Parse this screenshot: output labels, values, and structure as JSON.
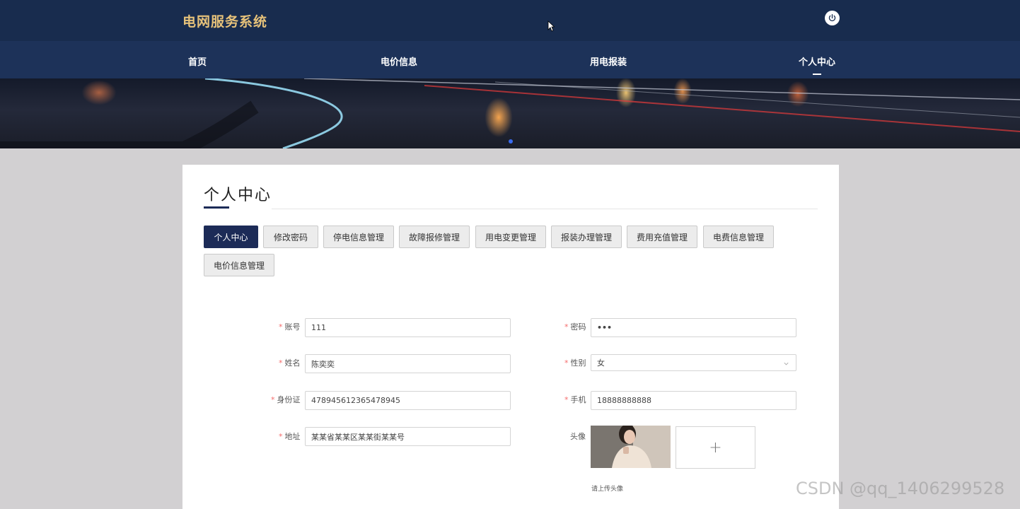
{
  "header": {
    "brand": "电网服务系统",
    "power_icon": "power-icon"
  },
  "nav": {
    "items": [
      {
        "label": "首页"
      },
      {
        "label": "电价信息"
      },
      {
        "label": "用电报装"
      },
      {
        "label": "个人中心",
        "active": true
      }
    ]
  },
  "banner": {
    "carousel_indicator": "dot"
  },
  "card": {
    "title": "个人中心",
    "tabs": [
      {
        "label": "个人中心",
        "active": true
      },
      {
        "label": "修改密码"
      },
      {
        "label": "停电信息管理"
      },
      {
        "label": "故障报修管理"
      },
      {
        "label": "用电变更管理"
      },
      {
        "label": "报装办理管理"
      },
      {
        "label": "费用充值管理"
      },
      {
        "label": "电费信息管理"
      },
      {
        "label": "电价信息管理"
      }
    ]
  },
  "form": {
    "account_label": "账号",
    "account_value": "111",
    "password_label": "密码",
    "password_value": "•••",
    "name_label": "姓名",
    "name_value": "陈奕奕",
    "gender_label": "性别",
    "gender_value": "女",
    "idcard_label": "身份证",
    "idcard_value": "478945612365478945",
    "phone_label": "手机",
    "phone_value": "18888888888",
    "address_label": "地址",
    "address_value": "某某省某某区某某街某某号",
    "avatar_label": "头像",
    "upload_tip": "请上传头像",
    "required_mark": "*",
    "plus_symbol": "+"
  },
  "watermark": "CSDN @qq_1406299528",
  "colors": {
    "topbar": "#182c4e",
    "navbar": "#1d3259",
    "brand": "#e6c27a",
    "accent": "#1c2b57",
    "required": "#f56c6c"
  }
}
